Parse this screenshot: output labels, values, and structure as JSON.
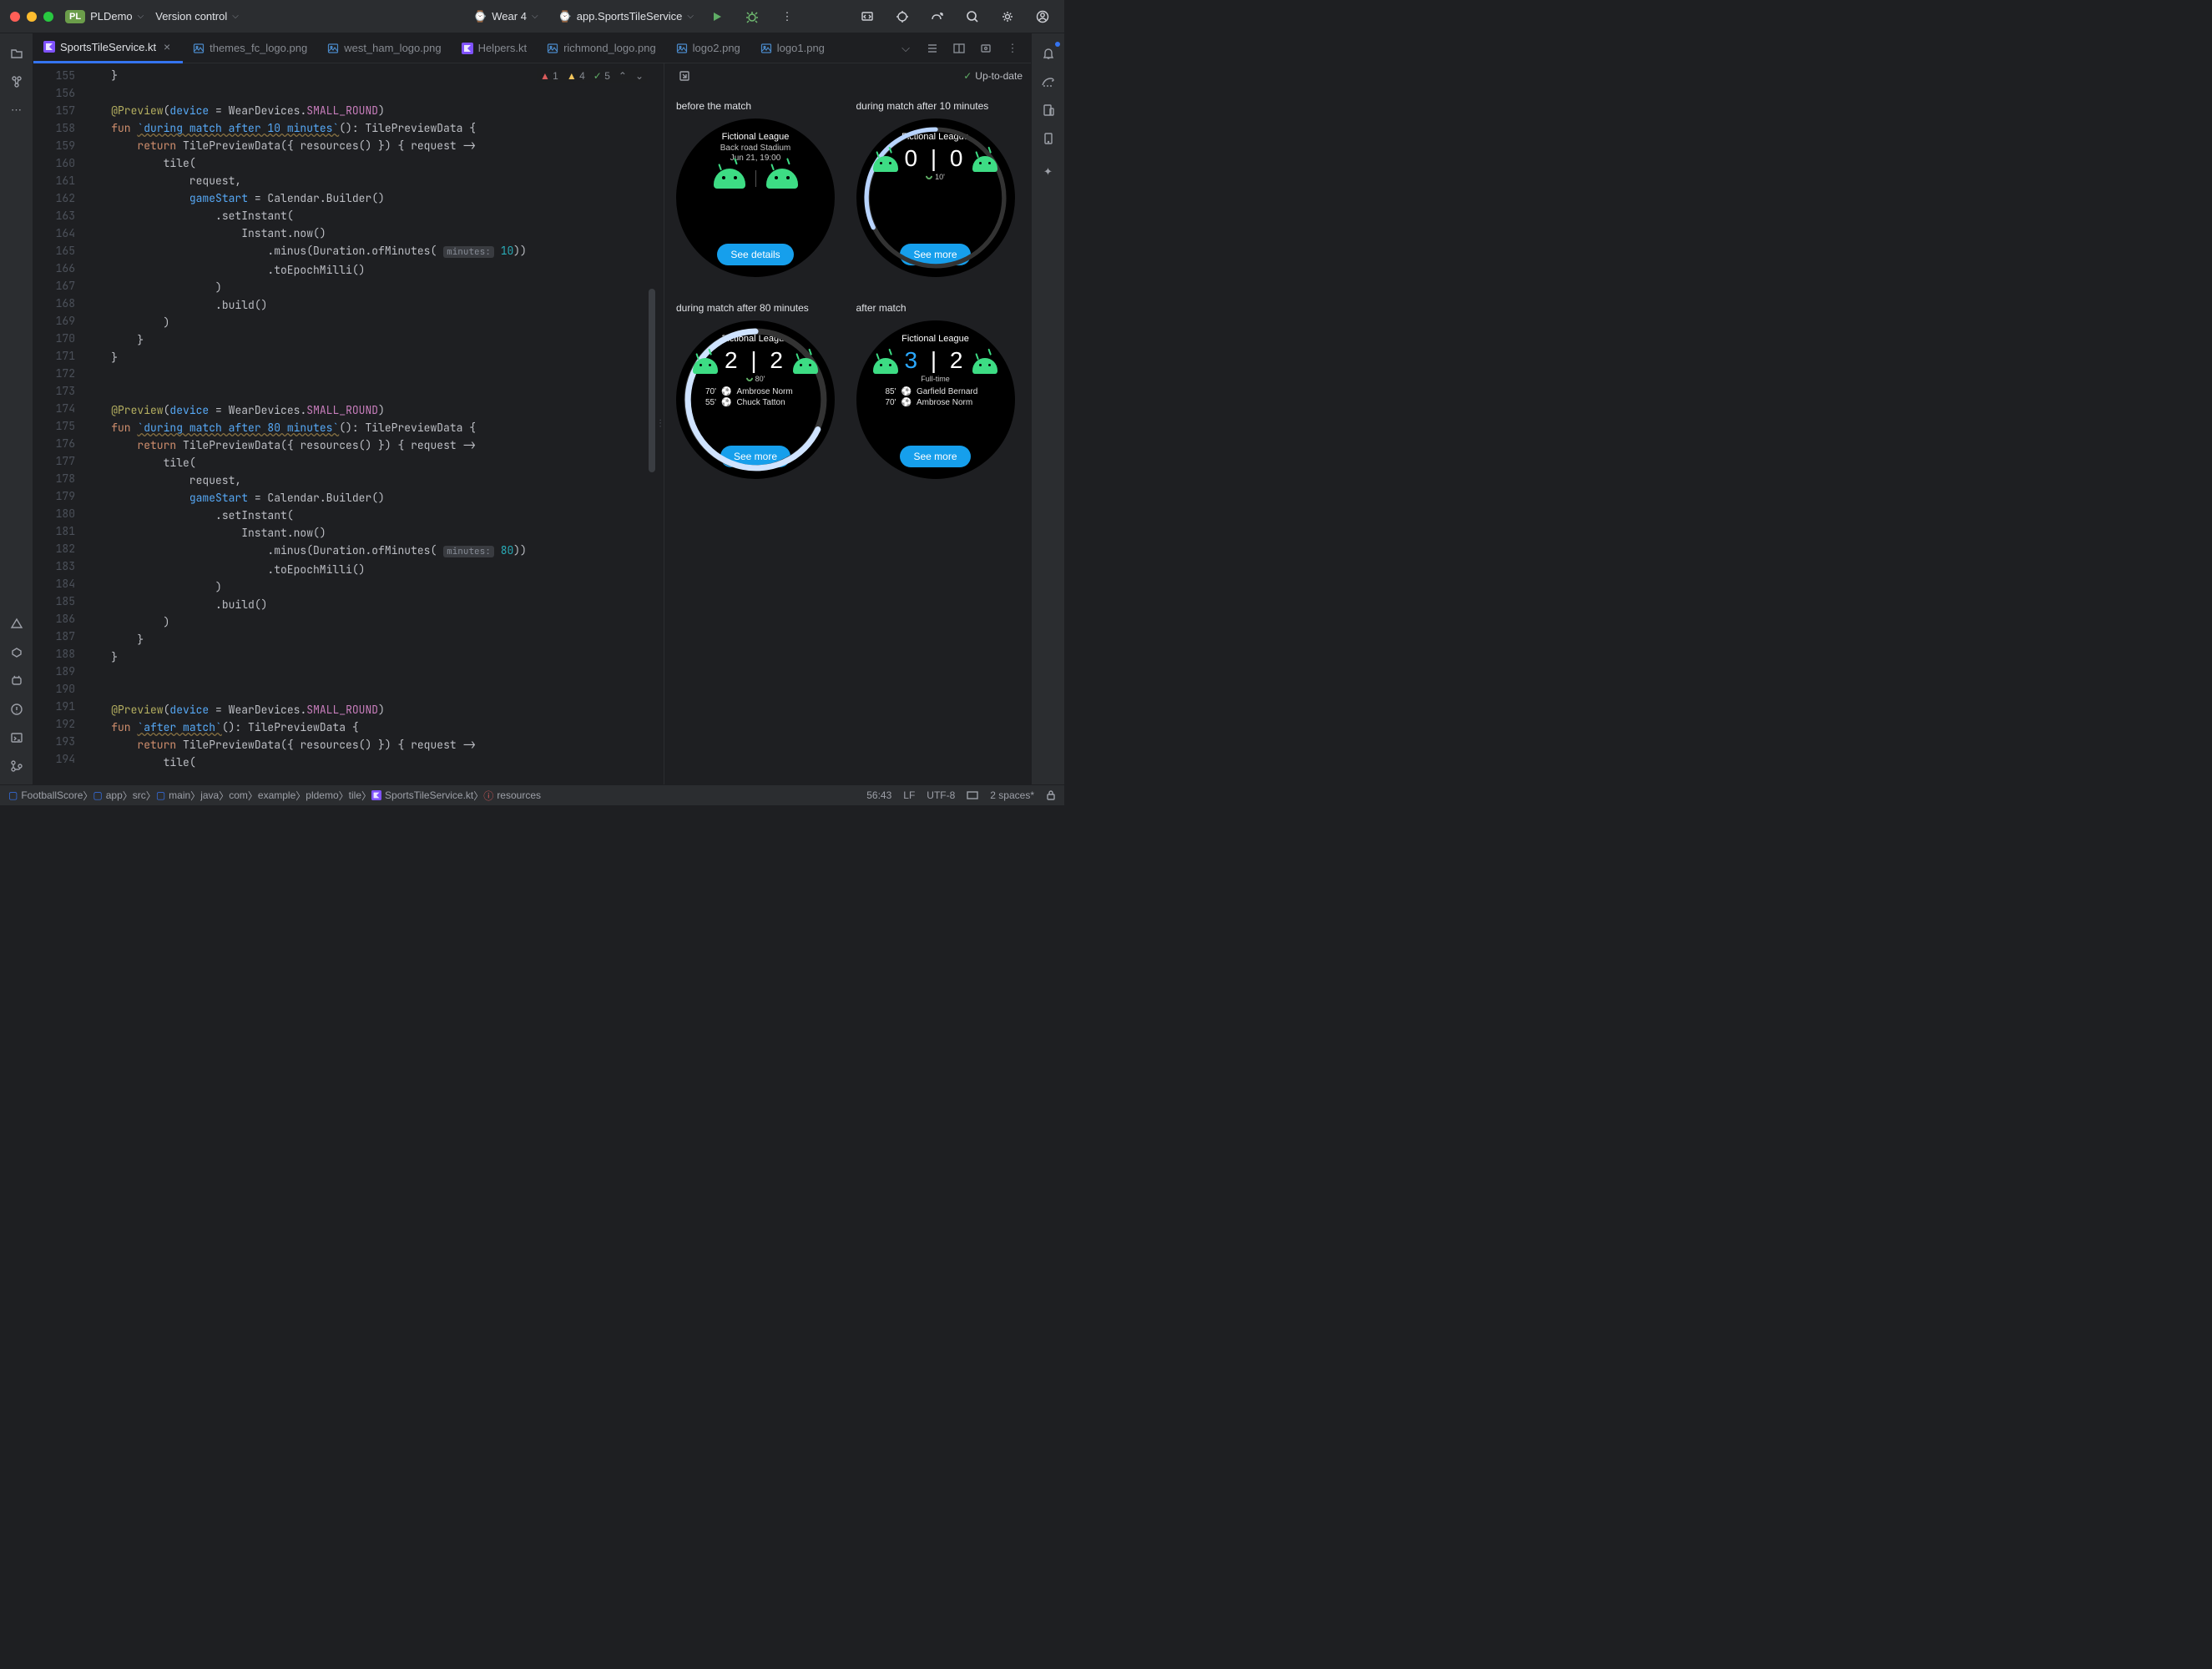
{
  "titlebar": {
    "project_badge": "PL",
    "project_name": "PLDemo",
    "vcs": "Version control",
    "device": "Wear 4",
    "run_config": "app.SportsTileService"
  },
  "tabs": [
    {
      "label": "SportsTileService.kt",
      "active": true,
      "kind": "kt"
    },
    {
      "label": "themes_fc_logo.png",
      "kind": "img"
    },
    {
      "label": "west_ham_logo.png",
      "kind": "img"
    },
    {
      "label": "Helpers.kt",
      "kind": "kt"
    },
    {
      "label": "richmond_logo.png",
      "kind": "img"
    },
    {
      "label": "logo2.png",
      "kind": "img"
    },
    {
      "label": "logo1.png",
      "kind": "img"
    }
  ],
  "inspections": {
    "errors": "1",
    "warnings": "4",
    "ok": "5"
  },
  "gutter_start": 155,
  "gutter_end": 194,
  "code_lines": [
    "    }",
    "",
    "    @Preview(device = WearDevices.SMALL_ROUND)",
    "    fun `during match after 10 minutes`(): TilePreviewData {",
    "        return TilePreviewData({ resources() }) { request ->",
    "            tile(",
    "                request,",
    "                gameStart = Calendar.Builder()",
    "                    .setInstant(",
    "                        Instant.now()",
    "                            .minus(Duration.ofMinutes( minutes: 10))",
    "                            .toEpochMilli()",
    "                    )",
    "                    .build()",
    "            )",
    "        }",
    "    }",
    "",
    "",
    "    @Preview(device = WearDevices.SMALL_ROUND)",
    "    fun `during match after 80 minutes`(): TilePreviewData {",
    "        return TilePreviewData({ resources() }) { request ->",
    "            tile(",
    "                request,",
    "                gameStart = Calendar.Builder()",
    "                    .setInstant(",
    "                        Instant.now()",
    "                            .minus(Duration.ofMinutes( minutes: 80))",
    "                            .toEpochMilli()",
    "                    )",
    "                    .build()",
    "            )",
    "        }",
    "    }",
    "",
    "",
    "    @Preview(device = WearDevices.SMALL_ROUND)",
    "    fun `after match`(): TilePreviewData {",
    "        return TilePreviewData({ resources() }) { request ->",
    "            tile("
  ],
  "preview": {
    "status": "Up-to-date",
    "items": [
      {
        "label": "before the match",
        "league": "Fictional League",
        "sub1": "Back road Stadium",
        "sub2": "Jun 21, 19:00",
        "btn": "See details"
      },
      {
        "label": "during match after 10 minutes",
        "league": "Fictional League",
        "score": "0 | 0",
        "time": "10'",
        "btn": "See more"
      },
      {
        "label": "during match after 80 minutes",
        "league": "Fictional League",
        "score": "2 | 2",
        "time": "80'",
        "btn": "See more",
        "scorers": [
          {
            "m": "70'",
            "n": "Ambrose Norm"
          },
          {
            "m": "55'",
            "n": "Chuck Tatton"
          }
        ]
      },
      {
        "label": "after match",
        "league": "Fictional League",
        "score_a": "3",
        "score_b": "2",
        "time": "Full-time",
        "btn": "See more",
        "scorers": [
          {
            "m": "85'",
            "n": "Garfield Bernard"
          },
          {
            "m": "70'",
            "n": "Ambrose Norm"
          }
        ]
      }
    ]
  },
  "breadcrumbs": [
    "FootballScore",
    "app",
    "src",
    "main",
    "java",
    "com",
    "example",
    "pldemo",
    "tile",
    "SportsTileService.kt",
    "resources"
  ],
  "status": {
    "pos": "56:43",
    "le": "LF",
    "enc": "UTF-8",
    "indent": "2 spaces*"
  }
}
